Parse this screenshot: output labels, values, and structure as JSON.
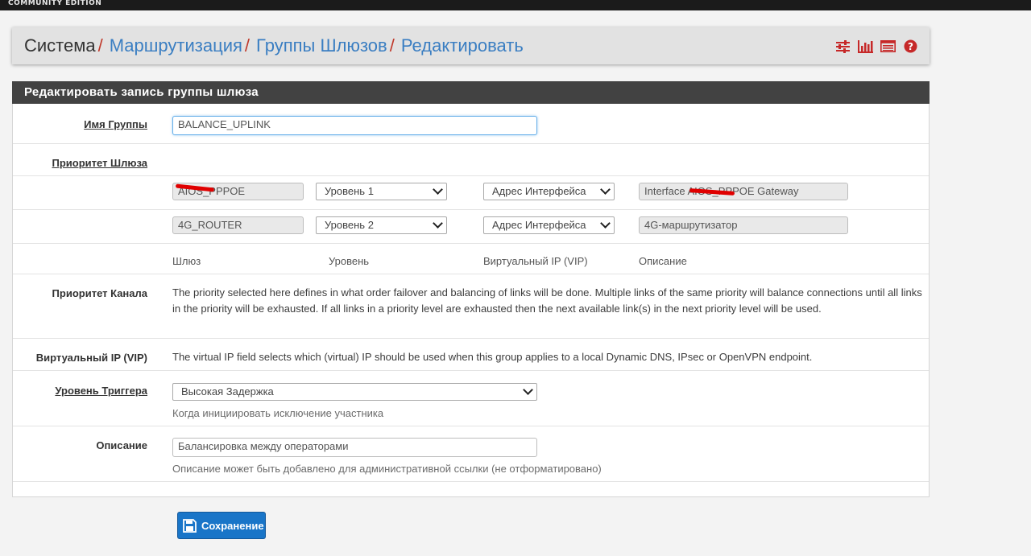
{
  "topbar": {
    "edition": "COMMUNITY EDITION"
  },
  "breadcrumb": {
    "items": [
      "Система",
      "Маршрутизация",
      "Группы Шлюзов",
      "Редактировать"
    ],
    "separator": "/"
  },
  "header_icons": [
    "sliders-icon",
    "bar-chart-icon",
    "list-table-icon",
    "help-icon"
  ],
  "panel": {
    "title": "Редактировать запись группы шлюза"
  },
  "group_name": {
    "label": "Имя Группы",
    "value": "BALANCE_UPLINK"
  },
  "gateway_priority": {
    "label": "Приоритет Шлюза",
    "rows": [
      {
        "gateway": "AIOS_PPPOE",
        "tier": "Уровень 1",
        "vip": "Адрес Интерфейса",
        "description": "Interface AIOS_PPPOE Gateway"
      },
      {
        "gateway": "4G_ROUTER",
        "tier": "Уровень 2",
        "vip": "Адрес Интерфейса",
        "description": "4G-маршрутизатор"
      }
    ],
    "columns": {
      "gateway": "Шлюз",
      "tier": "Уровень",
      "vip": "Виртуальный IP (VIP)",
      "description": "Описание"
    }
  },
  "link_priority": {
    "label": "Приоритет Канала",
    "text": "The priority selected here defines in what order failover and balancing of links will be done. Multiple links of the same priority will balance connections until all links in the priority will be exhausted. If all links in a priority level are exhausted then the next available link(s) in the next priority level will be used."
  },
  "virtual_ip": {
    "label": "Виртуальный IP (VIP)",
    "text": "The virtual IP field selects which (virtual) IP should be used when this group applies to a local Dynamic DNS, IPsec or OpenVPN endpoint."
  },
  "trigger_level": {
    "label": "Уровень Триггера",
    "value": "Высокая Задержка",
    "help": "Когда инициировать исключение участника"
  },
  "description": {
    "label": "Описание",
    "value": "Балансировка между операторами",
    "help": "Описание может быть добавлено для административной ссылки (не отформатировано)"
  },
  "save_button": {
    "label": "Сохранение"
  },
  "colors": {
    "accent": "#3a7ec2",
    "separator": "#c0392b",
    "icon_red": "#c62828",
    "button": "#1975c8",
    "panel_header": "#424242"
  }
}
